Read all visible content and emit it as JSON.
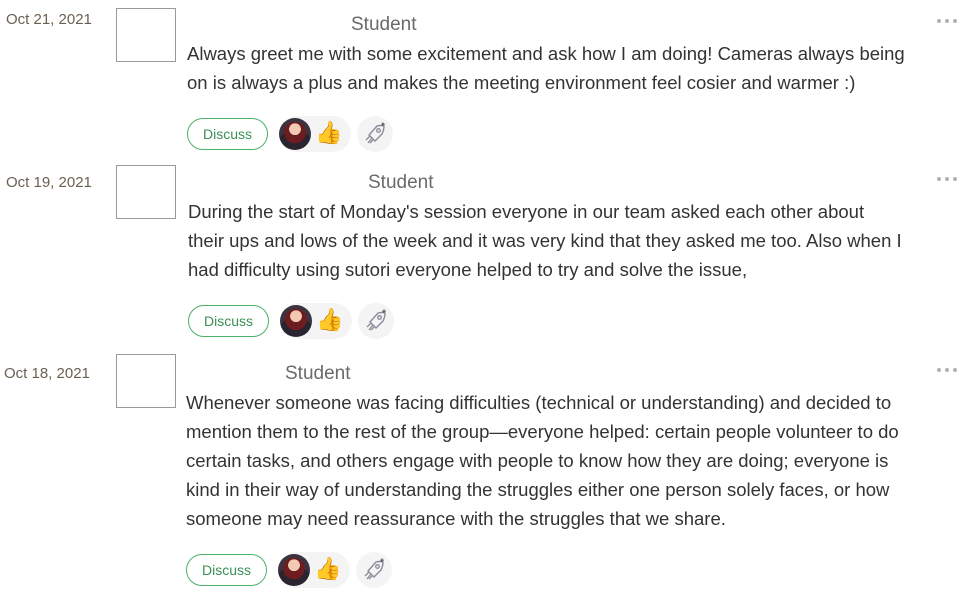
{
  "entries": [
    {
      "date": "Oct 21, 2021",
      "author": "Student",
      "lines": [
        "Always greet me with some excitement and ask how I am doing! Cameras always being",
        "on is always a plus and makes the meeting environment feel cosier and warmer :)"
      ],
      "discuss_label": "Discuss",
      "reaction_emoji": "👍"
    },
    {
      "date": "Oct 19, 2021",
      "author": "Student",
      "lines": [
        "During the start of Monday's session everyone in our team asked each other about",
        "their ups and lows of the week and it was very kind that they asked me too. Also when I",
        "had difficulty using sutori everyone helped to try and solve the issue,"
      ],
      "discuss_label": "Discuss",
      "reaction_emoji": "👍"
    },
    {
      "date": "Oct 18, 2021",
      "author": "Student",
      "lines": [
        "Whenever someone was facing difficulties (technical or understanding) and decided to",
        "mention them to the rest of the group—everyone helped: certain people volunteer to do",
        "certain tasks, and others engage with people to know how they are doing; everyone is",
        "kind in their way of understanding the struggles either one person solely faces, or how",
        "someone may need reassurance with the struggles that we share."
      ],
      "discuss_label": "Discuss",
      "reaction_emoji": "👍"
    }
  ],
  "icons": {
    "more": "more-dots-icon",
    "avatar": "user-avatar",
    "reaction": "thumbs-up-icon",
    "add_reaction": "rocket-add-icon"
  },
  "colors": {
    "discuss_border": "#4caf6a",
    "discuss_text": "#3a8f54",
    "date_text": "#6b5f52"
  }
}
